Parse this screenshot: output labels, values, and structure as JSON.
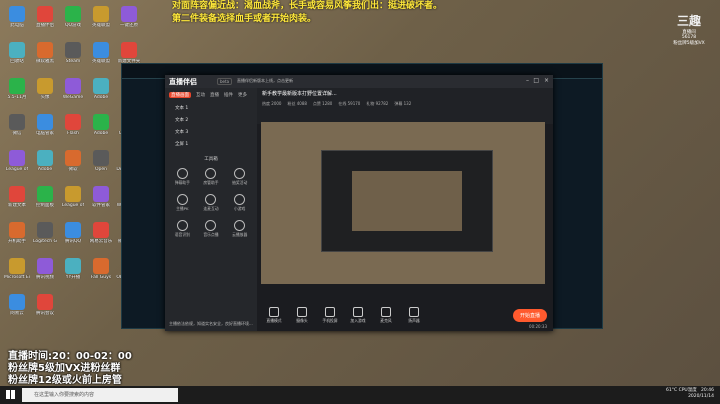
{
  "overlay": {
    "line1": "对面阵容偏近战：渴血战斧，长手或容易风筝我们出：挺进破坏者。",
    "line2": "第二件装备选择血手或者开始肉装。",
    "schedule": "直播时间:20：00-02：00",
    "fan1": "粉丝牌5级加VX进粉丝群",
    "fan2": "粉丝牌12级或火前上房管"
  },
  "desktop_icons": [
    "此电脑",
    "直播伴侣",
    "QQ游戏",
    "英雄联盟",
    "一键还原",
    "回收站",
    "微软雅黑",
    "Steam",
    "英雄联盟",
    "新建文件夹",
    "5.5-11月",
    "头像",
    "WeGame",
    "Adobe",
    "Adobe",
    "微信",
    "电脑管家",
    "Flash",
    "Adobe",
    "QQ浏览器",
    "League of",
    "Adobe",
    "微软",
    "Open",
    "DiskGenius",
    "新建文本",
    "控制面板",
    "League of",
    "软件管家",
    "WPS Office",
    "开机助手",
    "Logitech G",
    "腾讯QQ",
    "网易云音乐",
    "微信二维码",
    "Microsoft Edge",
    "腾讯视频",
    "YY开播",
    "Fall Guys",
    "OBS Studio",
    "网易云",
    "腾讯会议"
  ],
  "app": {
    "brand": "直播伴侣",
    "beta": "beta",
    "notice": "直播伴侣新版本上线，点击更新",
    "tabs": [
      "直播画面",
      "互动",
      "直播",
      "插件",
      "更多"
    ],
    "scenes": [
      "文本 1",
      "文本 2",
      "文本 3",
      "全屏 1"
    ],
    "tools_header": "工具箱",
    "tools": [
      "弹幕助手",
      "房管助手",
      "抽奖活动",
      "主播PK",
      "连麦互动",
      "小游戏",
      "语音识别",
      "音乐点播",
      "云播放器"
    ],
    "bottom_note": "主播依法依规，知道实名安全，良好直播环境..."
  },
  "main": {
    "title": "新手教学最新版本打野位置详解...",
    "stats": [
      "热度 2000",
      "粉丝 4088",
      "点赞 1280",
      "在线 59170",
      "礼物 92782",
      "弹幕 132"
    ],
    "controls": [
      "直播模式",
      "摄像头",
      "手机投屏",
      "加入游戏",
      "麦克风",
      "扬声器"
    ],
    "golive": "开始直播",
    "timer": "00:20:33"
  },
  "taskbar": {
    "search_placeholder": "在这里输入你要搜索的内容",
    "weather": "61°C CPU温度",
    "time": "20:46",
    "date": "2020/11/14"
  },
  "watermark": {
    "logo": "三趣",
    "line1": "直播间",
    "line2": "56178",
    "line3": "粉丝牌5级加VX"
  }
}
